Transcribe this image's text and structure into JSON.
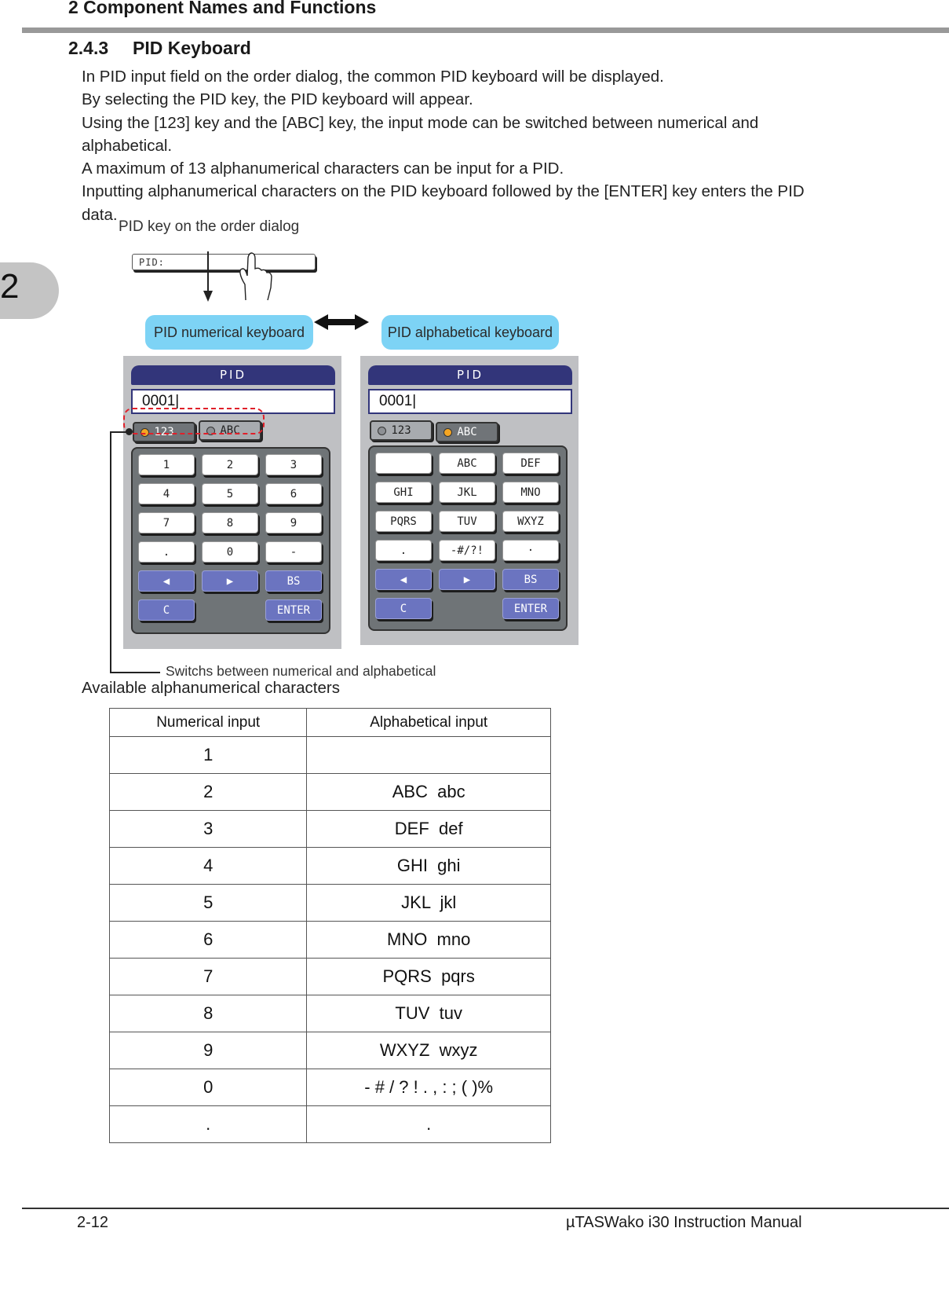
{
  "header": {
    "running_title": "2 Component Names and Functions",
    "section_number": "2.4.3",
    "section_title": "PID Keyboard"
  },
  "chapter_tab": "2",
  "body": {
    "paragraphs": [
      "In PID input field on the order dialog, the common PID keyboard will be displayed.",
      "By selecting the PID key, the PID keyboard will appear.",
      "Using the [123] key and the [ABC] key, the input mode can be switched between numerical and alphabetical.",
      "A maximum of 13 alphanumerical characters can be input for a PID.",
      "Inputting alphanumerical characters on the PID keyboard followed by the [ENTER] key enters the PID data."
    ]
  },
  "figure": {
    "pid_key_caption": "PID key on the order dialog",
    "pid_key_label": "PID:",
    "callout_numerical": "PID numerical keyboard",
    "callout_alphabetical": "PID alphabetical keyboard",
    "switch_caption": "Switchs between numerical and alphabetical",
    "colors": {
      "title_bar": "#32357a",
      "callout": "#7dd3f5",
      "active_led": "#f5a623",
      "highlight_dash": "#e0202a",
      "blue_key": "#6b74c0"
    },
    "numerical_keyboard": {
      "title": "PID",
      "input_value": "0001|",
      "mode_buttons": [
        {
          "label": "123",
          "active": true
        },
        {
          "label": "ABC",
          "active": false
        }
      ],
      "keys": [
        [
          "1",
          "2",
          "3"
        ],
        [
          "4",
          "5",
          "6"
        ],
        [
          "7",
          "8",
          "9"
        ],
        [
          ".",
          "0",
          "-"
        ],
        [
          "◀",
          "▶",
          "BS"
        ],
        [
          "C",
          "",
          "ENTER"
        ]
      ]
    },
    "alphabetical_keyboard": {
      "title": "PID",
      "input_value": "0001|",
      "mode_buttons": [
        {
          "label": "123",
          "active": false
        },
        {
          "label": "ABC",
          "active": true
        }
      ],
      "keys": [
        [
          "",
          "ABC",
          "DEF"
        ],
        [
          "GHI",
          "JKL",
          "MNO"
        ],
        [
          "PQRS",
          "TUV",
          "WXYZ"
        ],
        [
          ".",
          "-#/?!",
          "·"
        ],
        [
          "◀",
          "▶",
          "BS"
        ],
        [
          "C",
          "",
          "ENTER"
        ]
      ]
    }
  },
  "table": {
    "caption": "Available alphanumerical characters",
    "headers": [
      "Numerical input",
      "Alphabetical input"
    ],
    "rows": [
      [
        "1",
        ""
      ],
      [
        "2",
        "ABC  abc"
      ],
      [
        "3",
        "DEF  def"
      ],
      [
        "4",
        "GHI  ghi"
      ],
      [
        "5",
        "JKL  jkl"
      ],
      [
        "6",
        "MNO  mno"
      ],
      [
        "7",
        "PQRS  pqrs"
      ],
      [
        "8",
        "TUV  tuv"
      ],
      [
        "9",
        "WXYZ  wxyz"
      ],
      [
        "0",
        "- # / ? ! . , : ; ( )%"
      ],
      [
        ".",
        "."
      ]
    ]
  },
  "footer": {
    "page_number": "2-12",
    "manual_title": "µTASWako i30  Instruction Manual"
  }
}
